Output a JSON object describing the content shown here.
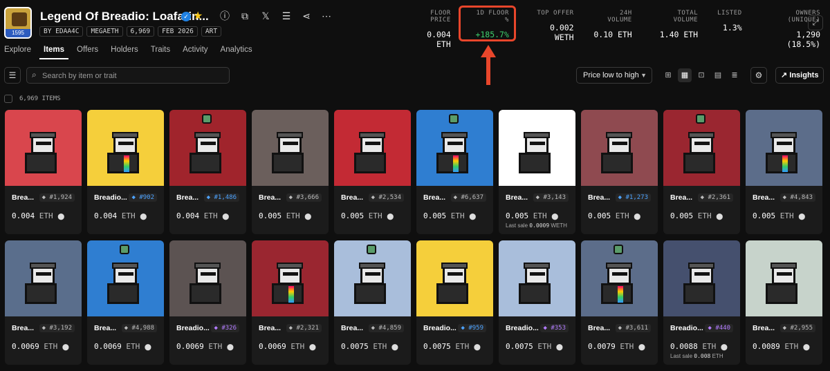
{
  "collection": {
    "logo_label": "1595",
    "title": "Legend Of Breadio: Loafarin...",
    "chips": [
      "BY EDAA4C",
      "MEGAETH",
      "6,969",
      "FEB 2026",
      "ART"
    ]
  },
  "header_icons": [
    "info-icon",
    "copy-icon",
    "x-icon",
    "stack-icon",
    "share-icon",
    "more-icon"
  ],
  "stats": [
    {
      "label": "FLOOR PRICE",
      "value": "0.004 ETH"
    },
    {
      "label": "1D FLOOR %",
      "value": "+185.7%"
    },
    {
      "label": "TOP OFFER",
      "value": "0.002 WETH"
    },
    {
      "label": "24H VOLUME",
      "value": "0.10 ETH"
    },
    {
      "label": "TOTAL VOLUME",
      "value": "1.40 ETH"
    },
    {
      "label": "LISTED",
      "value": "1.3%"
    },
    {
      "label": "OWNERS (UNIQUE)",
      "value": "1,290 (18.5%)"
    }
  ],
  "tabs": [
    "Explore",
    "Items",
    "Offers",
    "Holders",
    "Traits",
    "Activity",
    "Analytics"
  ],
  "active_tab": "Items",
  "search": {
    "placeholder": "Search by item or trait"
  },
  "sort": {
    "label": "Price low to high"
  },
  "insights_label": "Insights",
  "items_count": "6,969 ITEMS",
  "colors": {
    "highlight": "#e8462b",
    "positive": "#3ecf6d",
    "rare": "#4da3ff",
    "epic": "#b37cff"
  },
  "items": [
    {
      "name": "Brea...",
      "token": "#1,924",
      "tier": "common",
      "price": "0.004",
      "bg": "#d9464d"
    },
    {
      "name": "Breadio...",
      "token": "#902",
      "tier": "rare",
      "price": "0.004",
      "bg": "#f5cf3b"
    },
    {
      "name": "Brea...",
      "token": "#1,486",
      "tier": "rare",
      "price": "0.004",
      "bg": "#a0242c"
    },
    {
      "name": "Brea...",
      "token": "#3,666",
      "tier": "common",
      "price": "0.005",
      "bg": "#6b5f5c"
    },
    {
      "name": "Brea...",
      "token": "#2,534",
      "tier": "common",
      "price": "0.005",
      "bg": "#c32a34"
    },
    {
      "name": "Brea...",
      "token": "#6,637",
      "tier": "common",
      "price": "0.005",
      "bg": "#2f7ed1"
    },
    {
      "name": "Brea...",
      "token": "#3,143",
      "tier": "common",
      "price": "0.005",
      "bg": "#ffffff",
      "last_sale": "0.0009",
      "last_unit": "WETH"
    },
    {
      "name": "Brea...",
      "token": "#1,273",
      "tier": "rare",
      "price": "0.005",
      "bg": "#8f4a50"
    },
    {
      "name": "Brea...",
      "token": "#2,361",
      "tier": "common",
      "price": "0.005",
      "bg": "#9a2630"
    },
    {
      "name": "Brea...",
      "token": "#4,843",
      "tier": "common",
      "price": "0.005",
      "bg": "#5c6d8a"
    },
    {
      "name": "Brea...",
      "token": "#3,192",
      "tier": "common",
      "price": "0.0069",
      "bg": "#5a6e8c"
    },
    {
      "name": "Brea...",
      "token": "#4,988",
      "tier": "common",
      "price": "0.0069",
      "bg": "#2f7ed1"
    },
    {
      "name": "Breadio...",
      "token": "#326",
      "tier": "epic",
      "price": "0.0069",
      "bg": "#5c5352"
    },
    {
      "name": "Brea...",
      "token": "#2,321",
      "tier": "common",
      "price": "0.0069",
      "bg": "#9a2630"
    },
    {
      "name": "Brea...",
      "token": "#4,859",
      "tier": "common",
      "price": "0.0075",
      "bg": "#a9bedb"
    },
    {
      "name": "Breadio...",
      "token": "#959",
      "tier": "rare",
      "price": "0.0075",
      "bg": "#f5cf3b"
    },
    {
      "name": "Breadio...",
      "token": "#353",
      "tier": "epic",
      "price": "0.0075",
      "bg": "#a9bedb"
    },
    {
      "name": "Brea...",
      "token": "#3,611",
      "tier": "common",
      "price": "0.0079",
      "bg": "#5c6d8a"
    },
    {
      "name": "Breadio...",
      "token": "#440",
      "tier": "epic",
      "price": "0.0088",
      "bg": "#45506e",
      "last_sale": "0.008",
      "last_unit": "ETH"
    },
    {
      "name": "Brea...",
      "token": "#2,955",
      "tier": "common",
      "price": "0.0089",
      "bg": "#c7d3cb"
    }
  ],
  "price_unit": "ETH",
  "last_sale_label": "Last sale"
}
